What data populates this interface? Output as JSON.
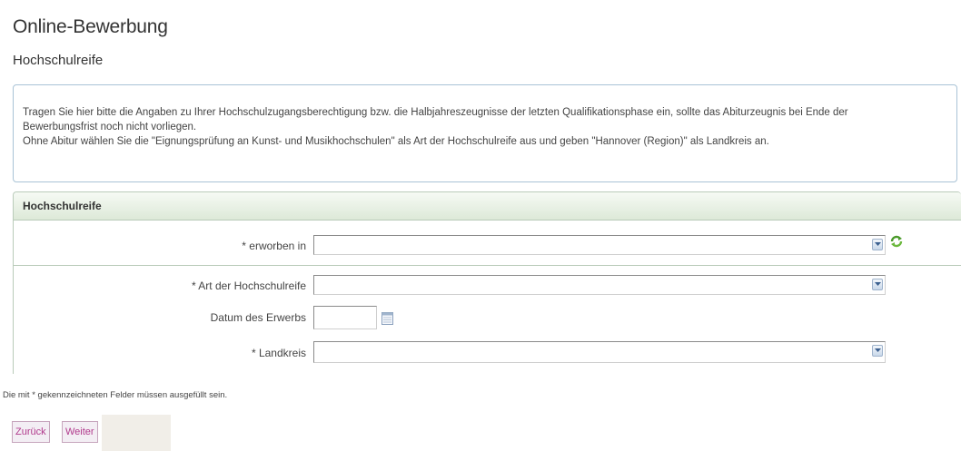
{
  "page": {
    "title": "Online-Bewerbung",
    "subtitle": "Hochschulreife"
  },
  "info": {
    "line1": "Tragen Sie hier bitte die Angaben zu Ihrer Hochschulzugangsberechtigung bzw. die Halbjahreszeugnisse der letzten Qualifikationsphase ein, sollte das Abiturzeugnis bei Ende der",
    "line2": "Bewerbungsfrist noch nicht vorliegen.",
    "line3": "Ohne Abitur wählen Sie die \"Eignungsprüfung an Kunst- und Musikhochschulen\" als Art der Hochschulreife aus und geben \"Hannover (Region)\" als Landkreis an."
  },
  "form": {
    "section_title": "Hochschulreife",
    "fields": {
      "erworben_in": {
        "label": "* erworben in",
        "value": ""
      },
      "art": {
        "label": "* Art der Hochschulreife",
        "value": ""
      },
      "datum": {
        "label": "Datum des Erwerbs",
        "value": ""
      },
      "landkreis": {
        "label": "* Landkreis",
        "value": ""
      }
    }
  },
  "footnote": "Die mit * gekennzeichneten Felder müssen ausgefüllt sein.",
  "buttons": {
    "back": "Zurück",
    "next": "Weiter"
  },
  "icons": {
    "dropdown": "chevron-down-icon",
    "refresh": "refresh-icon",
    "calendar": "calendar-icon"
  },
  "colors": {
    "button_text": "#b13a8c",
    "header_green": "#dde9d8",
    "info_border": "#a9c3d6"
  }
}
